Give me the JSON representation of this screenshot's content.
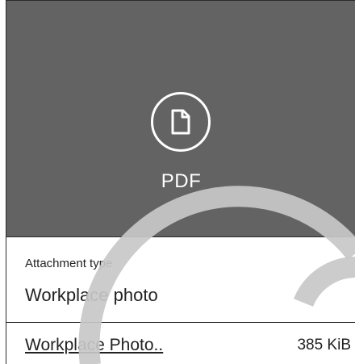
{
  "preview": {
    "icon": "file-icon",
    "type_label": "PDF"
  },
  "attachment": {
    "type_label": "Attachment type",
    "type_value": "Workplace photo"
  },
  "file": {
    "name": "Workplace Photo..",
    "size": "385 KiB"
  },
  "colors": {
    "preview_bg": "#636363",
    "overlay_arc": "#c8c8c8"
  }
}
